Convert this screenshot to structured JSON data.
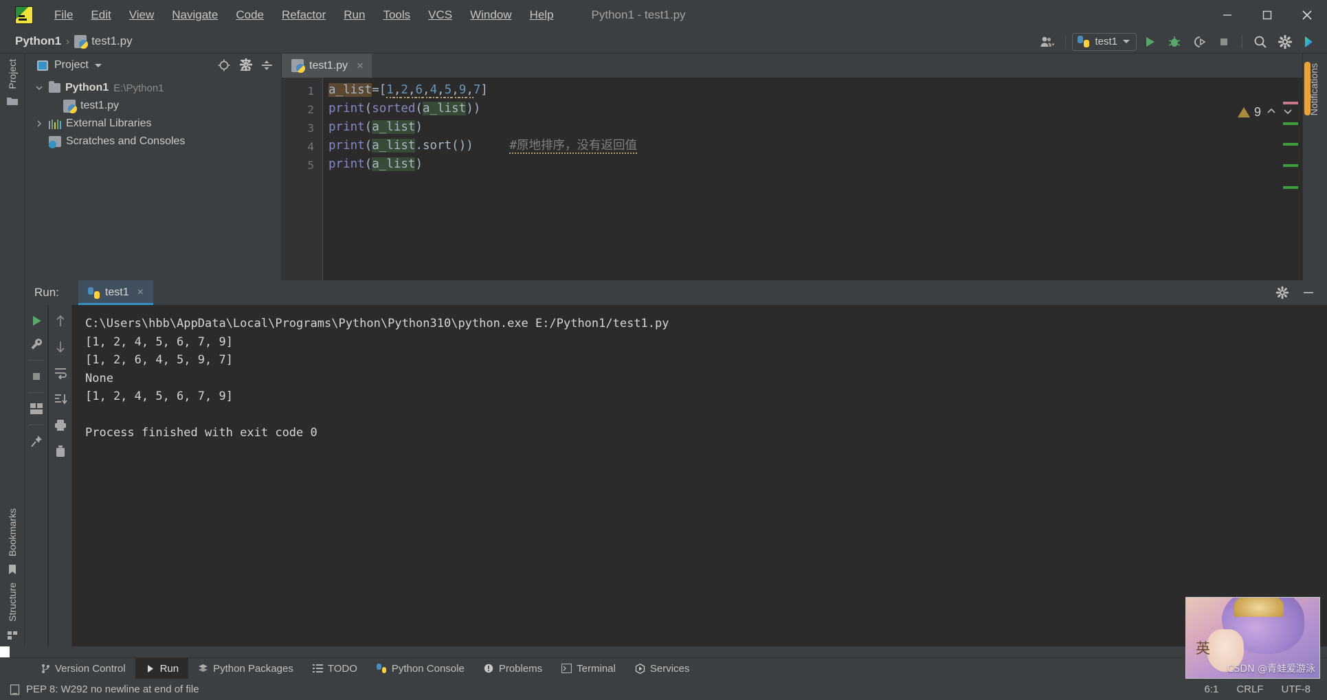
{
  "window": {
    "title": "Python1 - test1.py",
    "menus": [
      {
        "label": "File",
        "mnemonic": "F"
      },
      {
        "label": "Edit",
        "mnemonic": "E"
      },
      {
        "label": "View",
        "mnemonic": "V"
      },
      {
        "label": "Navigate",
        "mnemonic": "N"
      },
      {
        "label": "Code",
        "mnemonic": "C"
      },
      {
        "label": "Refactor",
        "mnemonic": "R"
      },
      {
        "label": "Run",
        "mnemonic": "u"
      },
      {
        "label": "Tools",
        "mnemonic": "T"
      },
      {
        "label": "VCS",
        "mnemonic": "S"
      },
      {
        "label": "Window",
        "mnemonic": "W"
      },
      {
        "label": "Help",
        "mnemonic": "H"
      }
    ],
    "controls": [
      "minimize",
      "maximize",
      "close"
    ]
  },
  "navbar": {
    "breadcrumb_project": "Python1",
    "breadcrumb_separator": "›",
    "breadcrumb_file": "test1.py",
    "run_config": "test1",
    "icons": [
      "user-icon",
      "run-icon",
      "debug-icon",
      "coverage-icon",
      "stop-icon",
      "search-icon",
      "settings-icon",
      "ide-feature-icon"
    ]
  },
  "left_rail": {
    "top": [
      "Project"
    ],
    "bottom": [
      "Bookmarks",
      "Structure"
    ]
  },
  "project_panel": {
    "title": "Project",
    "actions": [
      "target-icon",
      "expand-all-icon",
      "collapse-all-icon",
      "settings-icon",
      "hide-icon"
    ],
    "tree": [
      {
        "label": "Python1",
        "detail": "E:\\Python1",
        "kind": "folder",
        "expanded": true,
        "depth": 0
      },
      {
        "label": "test1.py",
        "detail": "",
        "kind": "python-file",
        "expanded": null,
        "depth": 1
      },
      {
        "label": "External Libraries",
        "detail": "",
        "kind": "library",
        "expanded": false,
        "depth": 0
      },
      {
        "label": "Scratches and Consoles",
        "detail": "",
        "kind": "scratch",
        "expanded": null,
        "depth": 0
      }
    ]
  },
  "editor": {
    "tab": {
      "label": "test1.py",
      "close": "×"
    },
    "warning_count": "9",
    "line_numbers": [
      "1",
      "2",
      "3",
      "4",
      "5"
    ],
    "code": [
      {
        "n": "1",
        "text": "a_list=[1,2,6,4,5,9,7]"
      },
      {
        "n": "2",
        "text": "print(sorted(a_list))"
      },
      {
        "n": "3",
        "text": "print(a_list)"
      },
      {
        "n": "4",
        "text": "print(a_list.sort())",
        "comment": "#原地排序，没有返回值"
      },
      {
        "n": "5",
        "text": "print(a_list)"
      }
    ],
    "right_rail": [
      "Notifications"
    ],
    "colors": {
      "keyword_fn": "#8888c6",
      "number": "#6897bb",
      "identifier": "#a9b7c6",
      "comment": "#808080",
      "background": "#2b2b2b",
      "highlight_occurrence": "#374b36",
      "highlight_write": "#5c4832"
    }
  },
  "run_panel": {
    "label": "Run:",
    "tab": "test1",
    "tab_close": "×",
    "left_tools": [
      "rerun-icon",
      "wrench-icon",
      "stop-icon",
      "layout-icon",
      "pin-icon"
    ],
    "second_tools": [
      "up-arrow-icon",
      "down-arrow-icon",
      "soft-wrap-icon",
      "scroll-to-end-icon",
      "print-icon",
      "trash-icon"
    ],
    "header_tools": [
      "settings-icon",
      "hide-icon"
    ],
    "output": [
      "C:\\Users\\hbb\\AppData\\Local\\Programs\\Python\\Python310\\python.exe E:/Python1/test1.py",
      "[1, 2, 4, 5, 6, 7, 9]",
      "[1, 2, 6, 4, 5, 9, 7]",
      "None",
      "[1, 2, 4, 5, 6, 7, 9]",
      "",
      "Process finished with exit code 0"
    ]
  },
  "bottom_tabs": [
    {
      "label": "Version Control",
      "icon": "branch-icon",
      "active": false
    },
    {
      "label": "Run",
      "icon": "play-icon",
      "active": true
    },
    {
      "label": "Python Packages",
      "icon": "packages-icon",
      "active": false
    },
    {
      "label": "TODO",
      "icon": "list-icon",
      "active": false
    },
    {
      "label": "Python Console",
      "icon": "python-icon",
      "active": false
    },
    {
      "label": "Problems",
      "icon": "problems-icon",
      "active": false
    },
    {
      "label": "Terminal",
      "icon": "terminal-icon",
      "active": false
    },
    {
      "label": "Services",
      "icon": "services-icon",
      "active": false
    }
  ],
  "status_bar": {
    "message": "PEP 8: W292 no newline at end of file",
    "message_icon": "inspection-icon",
    "caret": "6:1",
    "line_separator": "CRLF",
    "encoding": "UTF-8"
  },
  "watermark": {
    "text": "CSDN @青蛙爱游泳",
    "badge_char": "英"
  }
}
